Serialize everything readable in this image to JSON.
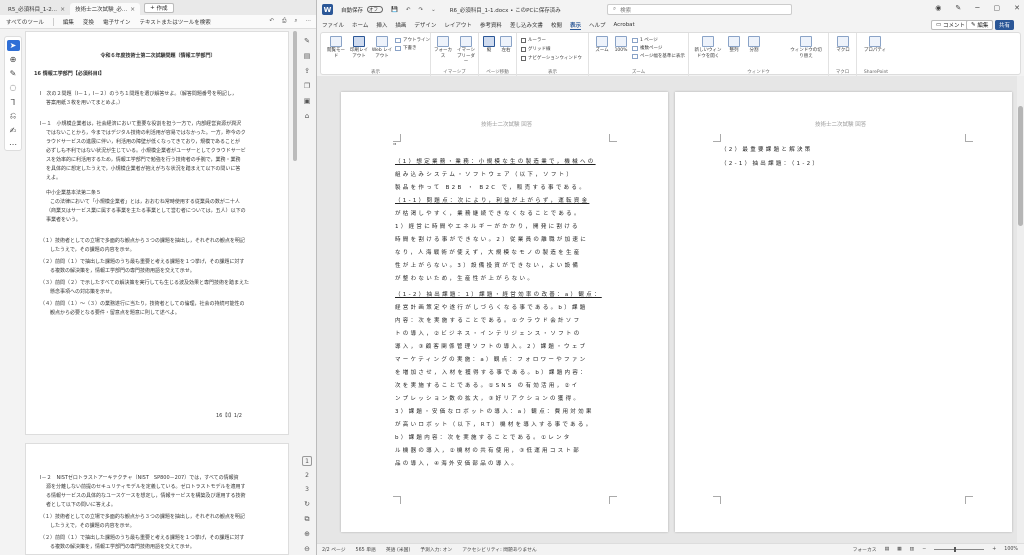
{
  "pdf": {
    "tabs": [
      {
        "label": "R5_必須科目_1-2..."
      },
      {
        "label": "技術士二次試験_必..."
      }
    ],
    "new_tab": "作成",
    "menu": [
      "すべてのツール",
      "編集",
      "変換",
      "電子サイン",
      "テキストまたはツールを検索"
    ],
    "page1_lines": [
      "令和６年度技術士第二次試験問題〔情報工学部門〕",
      "16 情報工学部門【必須科目Ⅰ】",
      "Ⅰ　次の２問題（Ⅰ－１，Ⅰ－２）のうち１問題を選び解答せよ。（解答問題番号を明記し，",
      "答案用紙３枚を用いてまとめよ。）",
      "Ⅰ－１　小規模企業者は，社会経済において重要な役割を担う一方で，内部経営資源が潤沢",
      "ではないことから，今まではデジタル技術の利活用が容易ではなかった。一方，昨今のク",
      "ラウドサービスの進展に伴い，利活用の障壁が低くなってきており，規模であることが",
      "必ずしも不利ではない状況が生じている。小規模企業者がユーザーとしてクラウドサービ",
      "スを効率的に利活用するため，情報工学部門で勉強を行う技術者の手腕で，業務・業務",
      "を具体的に想定したうえで，小規模企業者が抱えがちな状況を踏まえて以下の問いに答",
      "えよ。",
      "中小企業基本法第二条５",
      "この法律において「小規模企業者」とは，おおむね常時使用する従業員の数が二十人",
      "（商業又はサービス業に属する事業を主たる事業として営む者については，五人）以下の",
      "事業者をいう。",
      "（１）技術者としての立場で多面的な観点から３つの課題を抽出し，それぞれの観点を明記",
      "したうえで，その課題の内容を示せ。",
      "（２）前問（１）で抽出した課題のうち最も重要と考える課題を１つ挙げ，その課題に対す",
      "る複数の解決策を，情報工学部門の専門技術用語を交えて示せ。",
      "（３）前問（２）で示したすべての解決策を実行しても生じる波及効果と専門技術を踏まえた",
      "懸念事項への対応策を示せ。",
      "（４）前問（１）～（３）の業務遂行に当たり，技術者としての倫理，社会の持続可能性の",
      "観点から必要となる要件・留意点を題意に則して述べよ。"
    ],
    "page_footer": "16【Ⅰ】1/2",
    "page2_lines": [
      "Ⅰ－２　NISTゼロトラストアーキテクチャ（NIST　SP800－207）では，すべての情報資",
      "源を分離しない前提のセキュリティモデルを定義している。ゼロトラストモデルを適用す",
      "る情報サービスの具体的なユースケースを想定し，情報サービスを構築及び運用する技術",
      "者として以下の問いに答えよ。",
      "（１）技術者としての立場で多面的な観点から３つの課題を抽出し，それぞれの観点を明記",
      "したうえで，その課題の内容を示せ。",
      "（２）前問（１）で抽出した課題のうち最も重要と考える課題を１つ挙げ，その課題に対す",
      "る複数の解決策を，情報工学部門の専門技術用語を交えて示せ。"
    ],
    "page_numbers": [
      "2",
      "3",
      "4"
    ],
    "current_page": "1"
  },
  "word": {
    "autosave_label": "自動保存",
    "autosave_state": "オフ",
    "doc_title": "R6_必須科目_1-1.docx • このPCに保存済み",
    "search_placeholder": "検索",
    "tabs": [
      "ファイル",
      "ホーム",
      "挿入",
      "描画",
      "デザイン",
      "レイアウト",
      "参考資料",
      "差し込み文書",
      "校閲",
      "表示",
      "ヘルプ",
      "Acrobat"
    ],
    "active_tab": "表示",
    "comment_btn": "コメント",
    "edit_btn": "編集",
    "share_btn": "共有",
    "ribbon": {
      "groups": [
        "表示",
        "イマーシブ",
        "ページ移動",
        "表示",
        "ズーム",
        "ウィンドウ",
        "マクロ",
        "SharePoint"
      ],
      "buttons": [
        "閲覧モード",
        "印刷レイアウト",
        "Web レイアウト",
        "アウトライン",
        "下書き",
        "フォーカス",
        "イマーシブリーダー",
        "縦",
        "左右",
        "ルーラー",
        "グリッド線",
        "ナビゲーションウィンドウ",
        "ズーム",
        "100%",
        "1 ページ",
        "複数ページ",
        "ページ幅を基準に表示",
        "新しいウィンドウを開く",
        "整列",
        "分割",
        "ウィンドウの切り替え",
        "マクロ",
        "プロパティ"
      ]
    },
    "header_text": "技術士二次試験 回答",
    "page1_lines": [
      "（1）想定業務・業務：小規模な生の製造業で，機械への",
      "組み込みシステム・ソフトウェア（以下，ソフト）",
      "製品を作って B2B ・ B2C で，販売する事である。",
      "（1-1）問題点：次により，利益が上がらず，運転資金",
      "が枯渇しやすく，業務継続できなくなることである。",
      "1）経営に時間やエネルギーがかかり，開発に割ける",
      "時間を割ける事ができない。2）従業員の離職が加速に",
      "なり，人海戦術が使えず，大規模なモノの製造を生産",
      "性が上がらない。3）設備投資ができない，よい設備",
      "が整わないため，生産性が上がらない。",
      "（1-2）抽出課題：1）課題・経営効率の改善：a）観点：",
      "経営計画策定や遂行がしづらくなる事である。b）課題",
      "内容：次を実施することである。①クラウド会計ソフ",
      "トの導入，②ビジネス・インテリジェンス・ソフトの",
      "導入，③顧客関係管理ソフトの導入。2）課題・ウェブ",
      "マーケティングの実施：a）観点：フォロワーやファン",
      "を増加させ，入材を獲得する事である。b）課題内容：",
      "次を実施することである。①SNS の有効活用，②イ",
      "ンプレッション数の拡大，③好リアクションの獲得。",
      "3）課題・安価なロボットの導入：a）観点：費用対効果",
      "が高いロボット（以下，RT）機材を導入する事である。",
      "b）課題内容：次を実施することである。①レンタ",
      "ル機器の導入，②機材の共有使用，③低運用コスト部",
      "品の導入，④海外安価部品の導入。"
    ],
    "page2_lines": [
      "（2）最重要課題と解決策",
      "（2-1）抽出課題：（1-2）"
    ],
    "status": {
      "page": "2/2 ページ",
      "words": "565 単語",
      "lang": "英語 (米国)",
      "input": "予測入力: オン",
      "access": "アクセシビリティ: 問題ありません",
      "focus": "フォーカス",
      "zoom": "100%"
    }
  }
}
